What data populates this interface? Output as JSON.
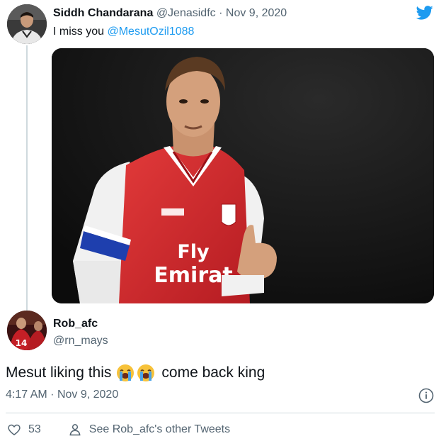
{
  "colors": {
    "accent": "#1d9bf0",
    "text": "#0f1419",
    "muted": "#536471",
    "divider": "#cfd9de",
    "arsenal_red": "#d8222a"
  },
  "tweet": {
    "author_name": "Siddh Chandarana",
    "author_handle": "@Jenasidfc",
    "separator": "·",
    "date": "Nov 9, 2020",
    "text_prefix": "I miss you",
    "mention": "@MesutOzil1088",
    "brand_icon": "twitter-bird-icon"
  },
  "reply": {
    "author_name": "Rob_afc",
    "author_handle": "@rn_mays",
    "text_before": "Mesut liking this",
    "emoji_icon": "loudly-crying-face-icon",
    "emoji_count": 2,
    "text_after": "come back king",
    "time": "4:17 AM",
    "separator": "·",
    "date": "Nov 9, 2020",
    "info_icon": "info-icon",
    "like_icon": "heart-icon",
    "like_count": "53",
    "profile_icon": "person-icon",
    "profile_link": "See Rob_afc's other Tweets"
  }
}
